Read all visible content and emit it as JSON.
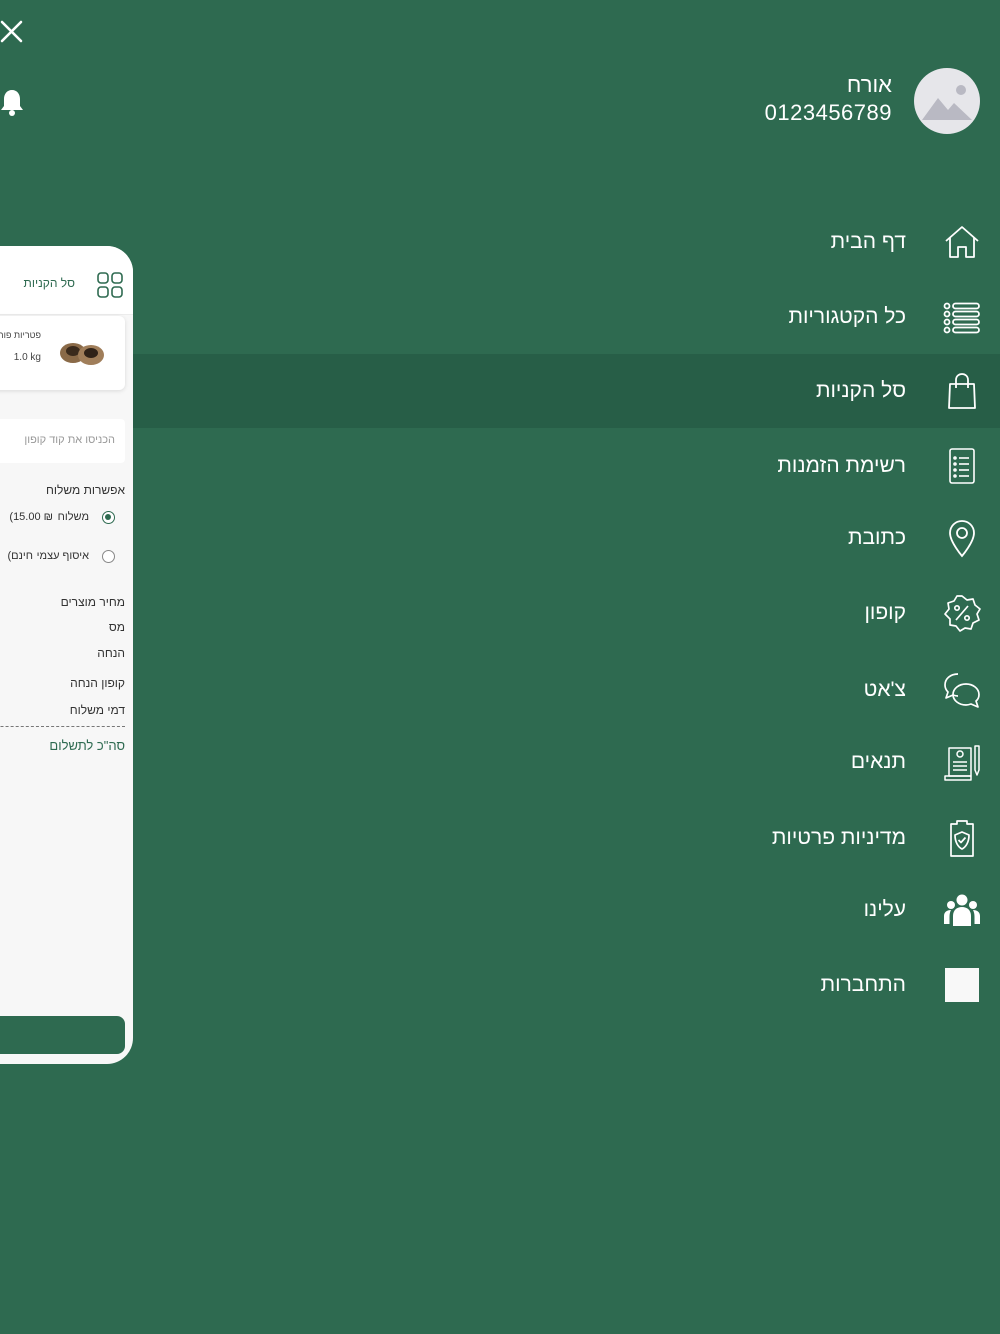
{
  "top_actions": {
    "close_icon": "close-icon",
    "bell_icon": "bell-icon"
  },
  "profile": {
    "name": "אורח",
    "phone": "0123456789",
    "avatar_icon": "image-placeholder-icon"
  },
  "menu": [
    {
      "label": "דף הבית",
      "icon": "home-icon",
      "active": false
    },
    {
      "label": "כל הקטגוריות",
      "icon": "list-icon",
      "active": false
    },
    {
      "label": "סל הקניות",
      "icon": "shopping-bag-icon",
      "active": true
    },
    {
      "label": "רשימת הזמנות",
      "icon": "order-list-icon",
      "active": false
    },
    {
      "label": "כתובת",
      "icon": "location-pin-icon",
      "active": false
    },
    {
      "label": "קופון",
      "icon": "coupon-icon",
      "active": false
    },
    {
      "label": "צ'אט",
      "icon": "chat-icon",
      "active": false
    },
    {
      "label": "תנאים",
      "icon": "terms-icon",
      "active": false
    },
    {
      "label": "מדיניות פרטיות",
      "icon": "privacy-shield-icon",
      "active": false
    },
    {
      "label": "עלינו",
      "icon": "team-icon",
      "active": false
    },
    {
      "label": "התחברות",
      "icon": "login-icon",
      "active": false
    }
  ],
  "cart": {
    "title": "סל הקניות",
    "product": {
      "name": "פטריות פור",
      "qty": "1.0 kg"
    },
    "coupon_placeholder": "הכניסו את קוד קופון",
    "shipping_title": "אפשרות משלוח",
    "shipping_options": [
      {
        "label": "משלוח",
        "price": "(15.00 ₪",
        "selected": true
      },
      {
        "label": "איסוף עצמי",
        "price": "(חינם",
        "selected": false
      }
    ],
    "summary": [
      "מחיר מוצרים",
      "מס",
      "הנחה",
      "קופון הנחה",
      "דמי משלוח"
    ],
    "total_label": "סה\"כ לתשלום"
  },
  "colors": {
    "background": "#2e6a50",
    "active_row": "#275e47",
    "panel": "#f7f7f7"
  }
}
